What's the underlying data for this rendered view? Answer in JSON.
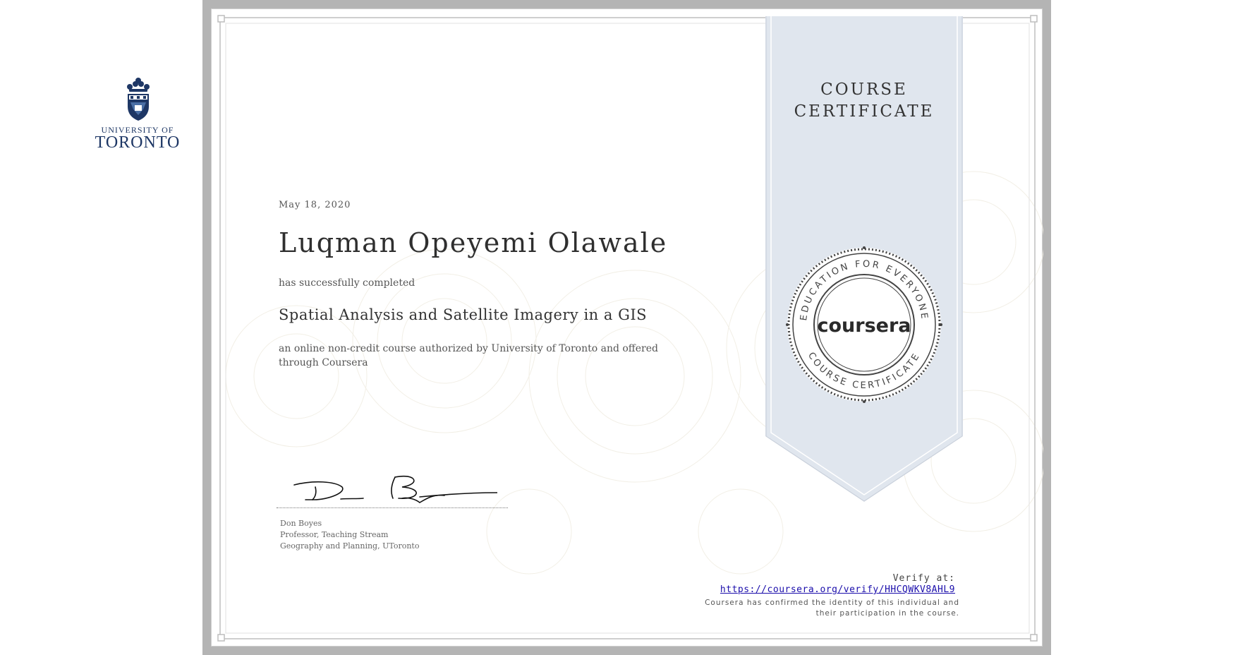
{
  "institution": {
    "line_small": "UNIVERSITY OF",
    "line_large": "TORONTO"
  },
  "certificate": {
    "date": "May 18, 2020",
    "recipient": "Luqman Opeyemi Olawale",
    "completed_text": "has successfully completed",
    "course_name": "Spatial Analysis and Satellite Imagery in a GIS",
    "description": "an online non-credit course authorized by University of Toronto and offered through Coursera"
  },
  "signatory": {
    "name": "Don Boyes",
    "title": "Professor, Teaching Stream",
    "department": "Geography and Planning, UToronto"
  },
  "ribbon": {
    "title_line1": "COURSE",
    "title_line2": "CERTIFICATE",
    "color": "#e0e6ee"
  },
  "seal": {
    "top_arc": "EDUCATION FOR EVERYONE",
    "bottom_arc": "COURSE CERTIFICATE",
    "wordmark": "coursera"
  },
  "verify": {
    "label": "Verify at:",
    "url": "https://coursera.org/verify/HHCQWKV8AHL9",
    "note_line1": "Coursera has confirmed the identity of this individual and",
    "note_line2": "their participation in the course."
  },
  "colors": {
    "frame": "#b4b4b4",
    "brand_navy": "#1e3765",
    "link": "#1a0dab"
  }
}
